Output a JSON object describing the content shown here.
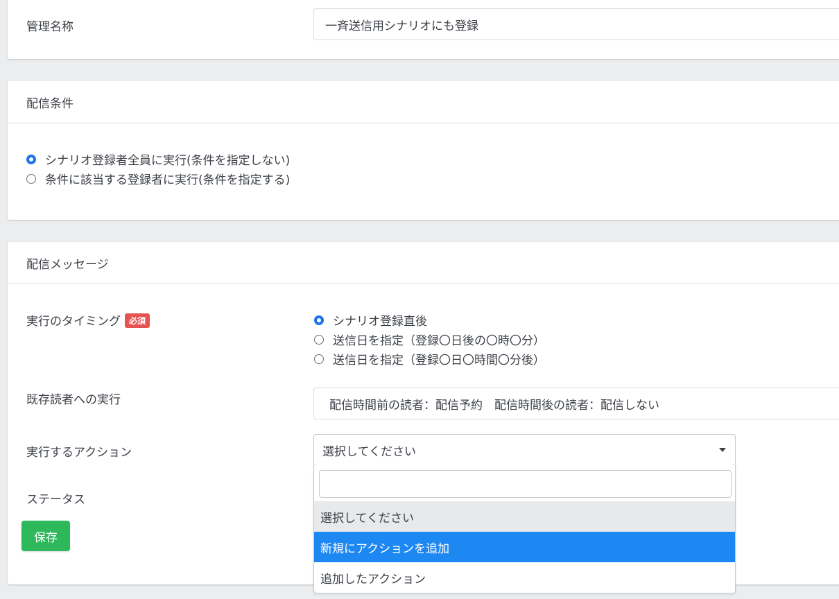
{
  "management_name": {
    "label": "管理名称",
    "value": "一斉送信用シナリオにも登録"
  },
  "delivery_conditions": {
    "title": "配信条件",
    "options": [
      {
        "label": "シナリオ登録者全員に実行(条件を指定しない)",
        "checked": true
      },
      {
        "label": "条件に該当する登録者に実行(条件を指定する)",
        "checked": false
      }
    ]
  },
  "delivery_message": {
    "title": "配信メッセージ",
    "timing": {
      "label": "実行のタイミング",
      "required_badge": "必須",
      "options": [
        {
          "label": "シナリオ登録直後",
          "checked": true
        },
        {
          "label": "送信日を指定（登録〇日後の〇時〇分）",
          "checked": false
        },
        {
          "label": "送信日を指定（登録〇日〇時間〇分後）",
          "checked": false
        }
      ]
    },
    "existing_readers": {
      "label": "既存読者への実行",
      "value": "配信時間前の読者：配信予約　配信時間後の読者：配信しない"
    },
    "action": {
      "label": "実行するアクション",
      "selected": "選択してください",
      "options": [
        "選択してください",
        "新規にアクションを追加",
        "追加したアクション"
      ]
    },
    "status": {
      "label": "ステータス"
    },
    "save_label": "保存"
  },
  "colors": {
    "accent": "#1a73e8",
    "highlight": "#1e88f2",
    "save_button": "#2eb85c",
    "required_badge": "#e55353"
  }
}
